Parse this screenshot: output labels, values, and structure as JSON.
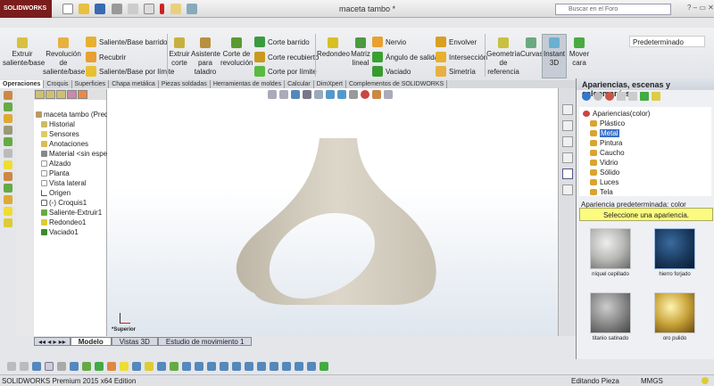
{
  "app": {
    "logo": "SOLIDWORKS",
    "document_title": "maceta tambo *",
    "search_placeholder": "Buscar en el Foro"
  },
  "command_manager": {
    "buttons": [
      {
        "label": "Extruir saliente/base",
        "icon": "extrude-boss-icon"
      },
      {
        "label": "Revolución de saliente/base",
        "icon": "revolve-boss-icon"
      },
      {
        "label": "Extruir corte",
        "icon": "extrude-cut-icon"
      },
      {
        "label": "Asistente para taladro",
        "icon": "hole-wizard-icon"
      },
      {
        "label": "Corte de revolución",
        "icon": "revolve-cut-icon"
      },
      {
        "label": "Redondeo",
        "icon": "fillet-icon"
      },
      {
        "label": "Matriz lineal",
        "icon": "linear-pattern-icon"
      },
      {
        "label": "Geometría de referencia",
        "icon": "reference-geometry-icon"
      },
      {
        "label": "Curvas",
        "icon": "curves-icon"
      },
      {
        "label": "Instant 3D",
        "icon": "instant3d-icon"
      },
      {
        "label": "Mover cara",
        "icon": "move-face-icon"
      }
    ],
    "rows": [
      "Saliente/Base barrido",
      "Recubrir",
      "Saliente/Base por límite",
      "Corte barrido",
      "Corte recubierto",
      "Corte por límite",
      "Nervio",
      "Ángulo de salida",
      "Vaciado",
      "Envolver",
      "Intersección",
      "Simetría"
    ],
    "configuration": "Predeterminado"
  },
  "tabs": [
    {
      "label": "Operaciones",
      "active": true
    },
    {
      "label": "Croquis"
    },
    {
      "label": "Superficies"
    },
    {
      "label": "Chapa metálica"
    },
    {
      "label": "Piezas soldadas"
    },
    {
      "label": "Herramientas de moldes"
    },
    {
      "label": "Calcular"
    },
    {
      "label": "DimXpert"
    },
    {
      "label": "Complementos de SOLIDWORKS"
    }
  ],
  "feature_tree": [
    "maceta tambo  (Predeterminado)",
    "Historial",
    "Sensores",
    "Anotaciones",
    "Material <sin especificar>",
    "Alzado",
    "Planta",
    "Vista lateral",
    "Origen",
    "(-) Croquis1",
    "Saliente-Extruir1",
    "Redondeo1",
    "Vaciado1"
  ],
  "viewport": {
    "view_label": "*Superior",
    "model_color": "#d8d2c4"
  },
  "bottom_tabs": [
    "Modelo",
    "Vistas 3D",
    "Estudio de movimiento 1"
  ],
  "task_pane": {
    "title": "Apariencias, escenas y calcomanías",
    "tree": [
      "Apariencias(color)",
      "Plástico",
      "Metal",
      "Pintura",
      "Caucho",
      "Vidrio",
      "Sólido",
      "Luces",
      "Tela"
    ],
    "selected": "Metal",
    "default_label": "Apariencia predeterminada: color",
    "hint": "Seleccione una apariencia.",
    "swatches": [
      {
        "label": "níquel cepillado",
        "color": "#b8b8b6"
      },
      {
        "label": "hierro forjado",
        "color": "#1a3a5e"
      },
      {
        "label": "titanio satinado",
        "color": "#8a8a8a"
      },
      {
        "label": "oro pulido",
        "color": "#c9a43a"
      }
    ]
  },
  "status": {
    "edition": "SOLIDWORKS Premium 2015 x64 Edition",
    "mode": "Editando Pieza",
    "units": "MMGS"
  }
}
